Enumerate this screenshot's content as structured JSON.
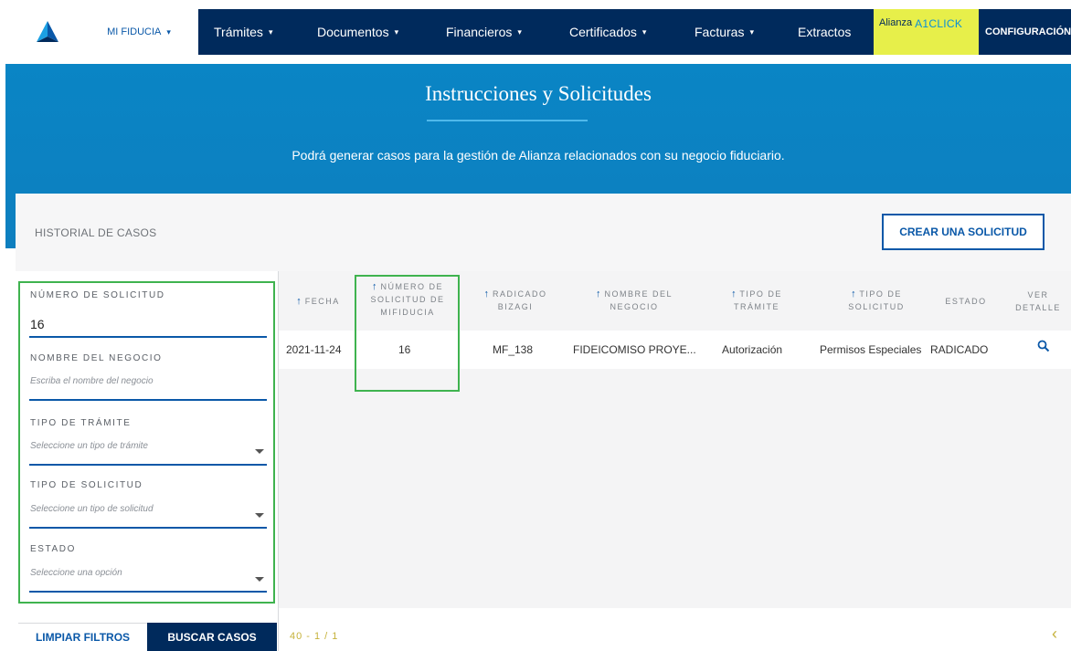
{
  "nav": {
    "items": [
      {
        "label": "MI FIDUCIA",
        "has_caret": true
      },
      {
        "label": "Trámites",
        "has_caret": true
      },
      {
        "label": "Documentos",
        "has_caret": true
      },
      {
        "label": "Financieros",
        "has_caret": true
      },
      {
        "label": "Certificados",
        "has_caret": true
      },
      {
        "label": "Facturas",
        "has_caret": true
      },
      {
        "label": "Extractos",
        "has_caret": false
      }
    ],
    "alianza_prefix": "Alianza",
    "alianza_brand": "A1CLICK",
    "config_label": "CONFIGURACIÓN",
    "caret_glyph": "▾"
  },
  "hero": {
    "title": "Instrucciones y Solicitudes",
    "subtitle": "Podrá generar casos para la gestión de Alianza relacionados con su negocio fiduciario."
  },
  "historial": {
    "title": "HISTORIAL DE CASOS",
    "create_button": "CREAR UNA SOLICITUD"
  },
  "filters": {
    "numero_label": "NÚMERO DE SOLICITUD",
    "numero_value": "16",
    "negocio_label": "NOMBRE DEL NEGOCIO",
    "negocio_placeholder": "Escriba el nombre del negocio",
    "tramite_label": "TIPO DE TRÁMITE",
    "tramite_placeholder": "Seleccione un tipo de trámite",
    "solicitud_label": "TIPO DE SOLICITUD",
    "solicitud_placeholder": "Seleccione un tipo de solicitud",
    "estado_label": "ESTADO",
    "estado_placeholder": "Seleccione una opción",
    "clear_button": "LIMPIAR FILTROS",
    "search_button": "BUSCAR CASOS"
  },
  "table": {
    "headers": [
      {
        "lines": [
          "FECHA"
        ],
        "sortable": true
      },
      {
        "lines": [
          "NÚMERO DE",
          "SOLICITUD DE",
          "MIFIDUCIA"
        ],
        "sortable": true
      },
      {
        "lines": [
          "RADICADO",
          "BIZAGI"
        ],
        "sortable": true
      },
      {
        "lines": [
          "NOMBRE DEL",
          "NEGOCIO"
        ],
        "sortable": true
      },
      {
        "lines": [
          "TIPO DE",
          "TRÁMITE"
        ],
        "sortable": true
      },
      {
        "lines": [
          "TIPO DE",
          "SOLICITUD"
        ],
        "sortable": true
      },
      {
        "lines": [
          "ESTADO"
        ],
        "sortable": false
      },
      {
        "lines": [
          "VER",
          "DETALLE"
        ],
        "sortable": false
      }
    ],
    "sort_arrow": "↑",
    "rows": [
      {
        "fecha": "2021-11-24",
        "numero": "16",
        "radicado": "MF_138",
        "negocio": "FIDEICOMISO PROYE...",
        "tramite": "Autorización",
        "solicitud": "Permisos Especiales",
        "estado": "RADICADO"
      }
    ],
    "pagination": "40 - 1 / 1",
    "prev_glyph": "‹"
  },
  "colors": {
    "navy": "#002a5c",
    "hero_blue": "#0a85c5",
    "accent_blue": "#0a58a8",
    "highlight_green": "#3fb34f",
    "alianza_yellow": "#e7ef4a",
    "pager_gold": "#c6b23b"
  }
}
